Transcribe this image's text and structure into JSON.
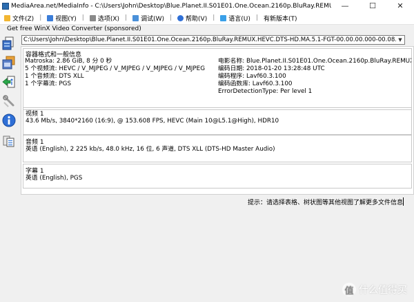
{
  "window": {
    "title": "MediaArea.net/MediaInfo - C:\\Users\\John\\Desktop\\Blue.Planet.II.S01E01.One.Ocean.2160p.BluRay.REMUX.HEVC.DTS-HD...",
    "minimize_glyph": "—",
    "maximize_glyph": "☐",
    "close_glyph": "✕"
  },
  "menu": [
    {
      "label": "文件(Z)",
      "icon": "folder-icon",
      "color": "#f2b632"
    },
    {
      "label": "视图(Y)",
      "icon": "view-icon",
      "color": "#3b7dd8"
    },
    {
      "label": "选项(X)",
      "icon": "options-icon",
      "color": "#8a8a8a"
    },
    {
      "label": "调试(W)",
      "icon": "debug-icon",
      "color": "#4a90d9"
    },
    {
      "label": "帮助(V)",
      "icon": "help-icon",
      "color": "#2f6fd6"
    },
    {
      "label": "语言(U)",
      "icon": "language-icon",
      "color": "#3aa0e8"
    },
    {
      "label": "有新版本(T)",
      "icon": "",
      "color": ""
    }
  ],
  "sponsor_text": "Get free WinX Video Converter (sponsored)",
  "file_combo": {
    "value": "C:\\Users\\John\\Desktop\\Blue.Planet.II.S01E01.One.Ocean.2160p.BluRay.REMUX.HEVC.DTS-HD.MA.5.1-FGT-00.00.00.000-00.08.00.0"
  },
  "general": {
    "title": "容器格式和一般信息",
    "left": [
      "Matroska: 2.86 GiB, 8 分 0 秒",
      "5 个视频流: HEVC / V_MJPEG / V_MJPEG / V_MJPEG / V_MJPEG",
      "1 个音频流: DTS XLL",
      "1 个字幕流: PGS"
    ],
    "right": [
      "电影名称: Blue.Planet.II.S01E01.One.Ocean.2160p.BluRay.REMUX.HE",
      "编码日期: 2018-01-20 13:28:48 UTC",
      "编码程序: Lavf60.3.100",
      "编码函数库: Lavf60.3.100",
      "ErrorDetectionType: Per level 1"
    ]
  },
  "video": {
    "title": "视频 1",
    "line": "43.6 Mb/s, 3840*2160 (16:9), @ 153.608 FPS, HEVC (Main 10@L5.1@High), HDR10"
  },
  "audio": {
    "title": "音频 1",
    "line": "英语 (English), 2 225 kb/s, 48.0 kHz, 16 位, 6 声道, DTS XLL (DTS-HD Master Audio)"
  },
  "subtitle": {
    "title": "字幕 1",
    "line": "英语 (English), PGS"
  },
  "hint": "提示：请选择表格、树状图等其他视图了解更多文件信息",
  "watermark": {
    "badge": "值",
    "text": "什么值得买"
  }
}
